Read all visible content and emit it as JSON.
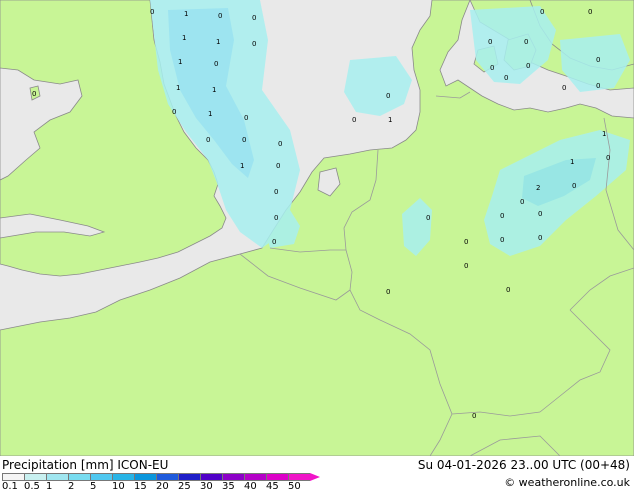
{
  "header": {
    "title_left": "Precipitation [mm]  ICON-EU",
    "title_right": "Su 04-01-2026 23..00 UTC (00+48)",
    "credit": "© weatheronline.co.uk"
  },
  "legend": {
    "ticks": [
      "0.1",
      "0.5",
      "1",
      "2",
      "5",
      "10",
      "15",
      "20",
      "25",
      "30",
      "35",
      "40",
      "45",
      "50"
    ],
    "colors": [
      "#f5f5f5",
      "#c8f0f0",
      "#a0e6f0",
      "#78dcf0",
      "#50c8f0",
      "#28b4e6",
      "#0a96dc",
      "#1e5adc",
      "#1e1ec8",
      "#5000c8",
      "#8c00c8",
      "#b400c8",
      "#dc00c8",
      "#f014c8"
    ]
  },
  "map": {
    "colors": {
      "sea": "#e9e9e9",
      "land": "#c8f596",
      "precip_light": "#a8f0f0",
      "precip_medium": "#90e4f2",
      "border": "#9a9a9a",
      "coast": "#8a8a8a"
    },
    "values": [
      "0",
      "1",
      "0",
      "1",
      "1",
      "0",
      "1",
      "0",
      "0",
      "1",
      "0",
      "1",
      "0",
      "1",
      "0",
      "0",
      "1",
      "0",
      "0",
      "0",
      "0",
      "1",
      "0",
      "0",
      "0",
      "0",
      "0",
      "0",
      "0",
      "0",
      "0",
      "0",
      "0",
      "0",
      "0",
      "1",
      "0",
      "1",
      "2",
      "0",
      "0",
      "0",
      "0",
      "0",
      "0",
      "0",
      "0",
      "0",
      "0",
      "0",
      "0",
      "0"
    ]
  }
}
